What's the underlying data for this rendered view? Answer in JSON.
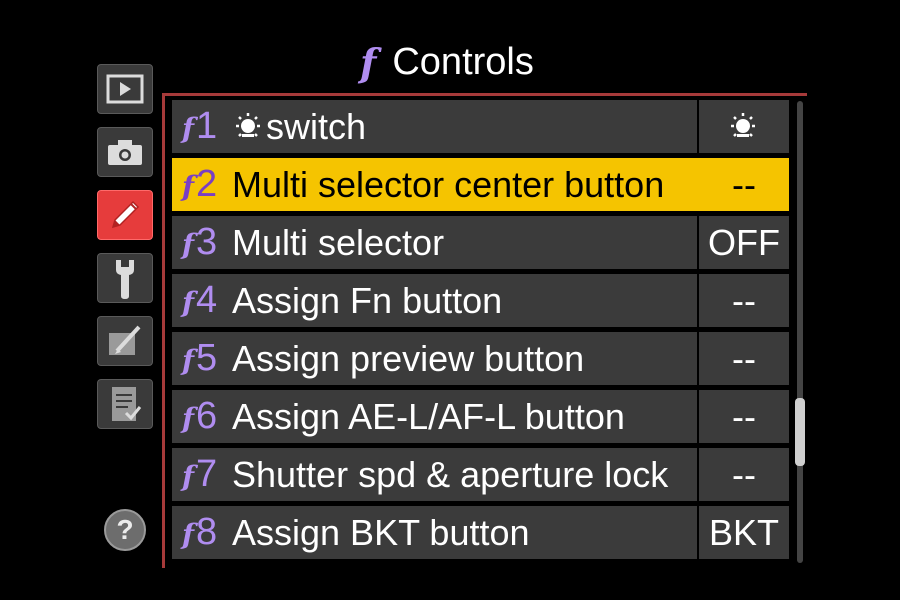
{
  "header": {
    "title": "Controls",
    "menu_glyph": "f",
    "icon": "custom-settings-f-icon"
  },
  "sidebar": {
    "tabs": [
      {
        "name": "playback-menu-tab",
        "icon": "play-icon",
        "active": false
      },
      {
        "name": "shooting-menu-tab",
        "icon": "camera-icon",
        "active": false
      },
      {
        "name": "custom-settings-menu-tab",
        "icon": "pencil-icon",
        "active": true
      },
      {
        "name": "setup-menu-tab",
        "icon": "wrench-icon",
        "active": false
      },
      {
        "name": "retouch-menu-tab",
        "icon": "retouch-brush-icon",
        "active": false
      },
      {
        "name": "my-menu-tab",
        "icon": "checklist-icon",
        "active": false
      }
    ],
    "help_label": "?"
  },
  "menu": {
    "items": [
      {
        "code_letter": "f",
        "code_number": "1",
        "icon": "illumination-icon",
        "label": "switch",
        "value": "",
        "value_icon": "illumination-icon",
        "selected": false
      },
      {
        "code_letter": "f",
        "code_number": "2",
        "label": "Multi selector center button",
        "value": "--",
        "selected": true
      },
      {
        "code_letter": "f",
        "code_number": "3",
        "label": "Multi selector",
        "value": "OFF",
        "selected": false
      },
      {
        "code_letter": "f",
        "code_number": "4",
        "label": "Assign Fn button",
        "value": "--",
        "selected": false
      },
      {
        "code_letter": "f",
        "code_number": "5",
        "label": "Assign preview button",
        "value": "--",
        "selected": false
      },
      {
        "code_letter": "f",
        "code_number": "6",
        "label": "Assign AE-L/AF-L button",
        "value": "--",
        "selected": false
      },
      {
        "code_letter": "f",
        "code_number": "7",
        "label": "Shutter spd & aperture lock",
        "value": "--",
        "selected": false
      },
      {
        "code_letter": "f",
        "code_number": "8",
        "label": "Assign BKT button",
        "value": "BKT",
        "selected": false
      }
    ]
  },
  "colors": {
    "accent_purple": "#b08df0",
    "selection_yellow": "#f5c400",
    "active_tab_red": "#e63c3c"
  }
}
